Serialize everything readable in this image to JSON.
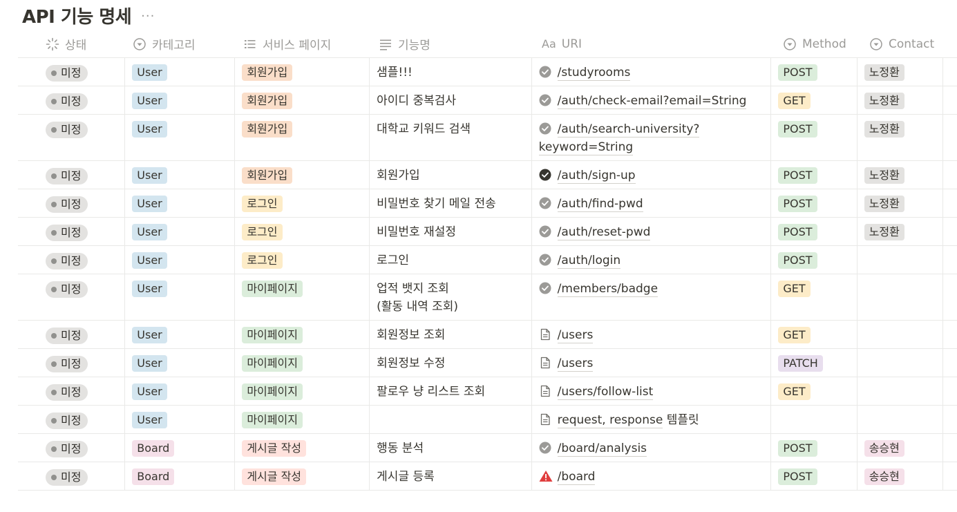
{
  "page": {
    "title": "API 기능 명세",
    "more_label": "···"
  },
  "columns": {
    "status": "상태",
    "category": "카테고리",
    "service_page": "서비스 페이지",
    "function_name": "기능명",
    "uri": "URI",
    "uri_prefix": "Aa",
    "method": "Method",
    "contact": "Contact"
  },
  "colors": {
    "category": {
      "User": "#d3e5ef",
      "Board": "#f5e0e9"
    },
    "page": {
      "회원가입": "#fadec9",
      "로그인": "#fdecc8",
      "마이페이지": "#dbeddb",
      "게시글 작성": "#ffe2dd"
    },
    "method": {
      "POST": "#dbeddb",
      "GET": "#fdecc8",
      "PATCH": "#e8deee"
    },
    "contact": {
      "노정환": "#e3e2e0",
      "송승현": "#f5e0e9"
    }
  },
  "rows": [
    {
      "status": "미정",
      "category": "User",
      "page": "회원가입",
      "name": "샘플!!!",
      "uri_icon": "check-circle-icon",
      "uri": "/studyrooms",
      "uri_cont": "",
      "method": "POST",
      "contact": "노정환"
    },
    {
      "status": "미정",
      "category": "User",
      "page": "회원가입",
      "name": "아이디 중복검사",
      "uri_icon": "check-circle-icon",
      "uri": "/auth/check-email?email=String",
      "uri_cont": "",
      "method": "GET",
      "contact": "노정환"
    },
    {
      "status": "미정",
      "category": "User",
      "page": "회원가입",
      "name": "대학교 키워드 검색",
      "uri_icon": "check-circle-icon",
      "uri": "/auth/search-university?",
      "uri_cont": "keyword=String",
      "method": "POST",
      "contact": "노정환"
    },
    {
      "status": "미정",
      "category": "User",
      "page": "회원가입",
      "name": "회원가입",
      "uri_icon": "check-circle-dark-icon",
      "uri": "/auth/sign-up",
      "uri_cont": "",
      "method": "POST",
      "contact": "노정환"
    },
    {
      "status": "미정",
      "category": "User",
      "page": "로그인",
      "name": "비밀번호 찾기 메일 전송",
      "uri_icon": "check-circle-icon",
      "uri": "/auth/find-pwd",
      "uri_cont": "",
      "method": "POST",
      "contact": "노정환"
    },
    {
      "status": "미정",
      "category": "User",
      "page": "로그인",
      "name": "비밀번호 재설정",
      "uri_icon": "check-circle-icon",
      "uri": "/auth/reset-pwd",
      "uri_cont": "",
      "method": "POST",
      "contact": "노정환"
    },
    {
      "status": "미정",
      "category": "User",
      "page": "로그인",
      "name": "로그인",
      "uri_icon": "check-circle-icon",
      "uri": "/auth/login",
      "uri_cont": "",
      "method": "POST",
      "contact": ""
    },
    {
      "status": "미정",
      "category": "User",
      "page": "마이페이지",
      "name": "업적 뱃지 조회\n(활동 내역 조회)",
      "uri_icon": "check-circle-icon",
      "uri": "/members/badge",
      "uri_cont": "",
      "method": "GET",
      "contact": ""
    },
    {
      "status": "미정",
      "category": "User",
      "page": "마이페이지",
      "name": "회원정보 조회",
      "uri_icon": "document-icon",
      "uri": "/users",
      "uri_cont": "",
      "method": "GET",
      "contact": ""
    },
    {
      "status": "미정",
      "category": "User",
      "page": "마이페이지",
      "name": "회원정보 수정",
      "uri_icon": "document-icon",
      "uri": "/users",
      "uri_cont": "",
      "method": "PATCH",
      "contact": ""
    },
    {
      "status": "미정",
      "category": "User",
      "page": "마이페이지",
      "name": "팔로우 냥 리스트 조회",
      "uri_icon": "document-icon",
      "uri": "/users/follow-list",
      "uri_cont": "",
      "method": "GET",
      "contact": ""
    },
    {
      "status": "미정",
      "category": "User",
      "page": "마이페이지",
      "name": "",
      "uri_icon": "document-icon",
      "uri": "request, response",
      "uri_suffix": " 템플릿",
      "uri_cont": "",
      "method": "",
      "contact": ""
    },
    {
      "status": "미정",
      "category": "Board",
      "page": "게시글 작성",
      "name": "행동 분석",
      "uri_icon": "check-circle-icon",
      "uri": "/board/analysis",
      "uri_cont": "",
      "method": "POST",
      "contact": "송승현"
    },
    {
      "status": "미정",
      "category": "Board",
      "page": "게시글 작성",
      "name": "게시글 등록",
      "uri_icon": "warning-icon",
      "uri": "/board",
      "uri_cont": "",
      "method": "POST",
      "contact": "송승현"
    }
  ]
}
